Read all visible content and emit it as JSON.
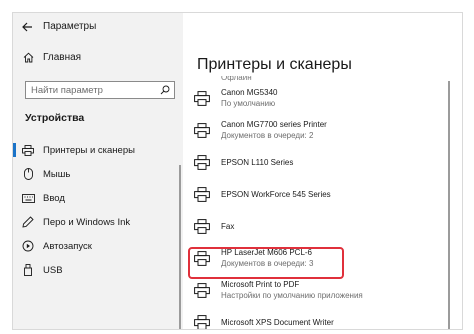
{
  "window": {
    "title": "Параметры",
    "back_icon": "back-arrow-icon"
  },
  "sidebar": {
    "home_label": "Главная",
    "search_placeholder": "Найти параметр",
    "section_title": "Устройства",
    "items": [
      {
        "label": "Принтеры и сканеры",
        "icon": "printer-icon",
        "active": true
      },
      {
        "label": "Мышь",
        "icon": "mouse-icon",
        "active": false
      },
      {
        "label": "Ввод",
        "icon": "keyboard-icon",
        "active": false
      },
      {
        "label": "Перо и Windows Ink",
        "icon": "pen-icon",
        "active": false
      },
      {
        "label": "Автозапуск",
        "icon": "autoplay-icon",
        "active": false
      },
      {
        "label": "USB",
        "icon": "usb-icon",
        "active": false
      }
    ]
  },
  "main": {
    "title": "Принтеры и сканеры",
    "cutoff_status": "Офлайн",
    "printers": [
      {
        "name": "Canon MG5340",
        "status": "По умолчанию"
      },
      {
        "name": "Canon MG7700 series Printer",
        "status": "Документов в очереди: 2"
      },
      {
        "name": "EPSON L110 Series",
        "status": ""
      },
      {
        "name": "EPSON WorkForce 545 Series",
        "status": ""
      },
      {
        "name": "Fax",
        "status": ""
      },
      {
        "name": "HP LaserJet M606 PCL-6",
        "status": "Документов в очереди: 3",
        "highlighted": true
      },
      {
        "name": "Microsoft Print to PDF",
        "status": "Настройки по умолчанию приложения"
      },
      {
        "name": "Microsoft XPS Document Writer",
        "status": ""
      }
    ]
  },
  "colors": {
    "accent": "#1a73c8",
    "highlight_border": "#e0303b",
    "sidebar_bg": "#f2f2f2"
  }
}
